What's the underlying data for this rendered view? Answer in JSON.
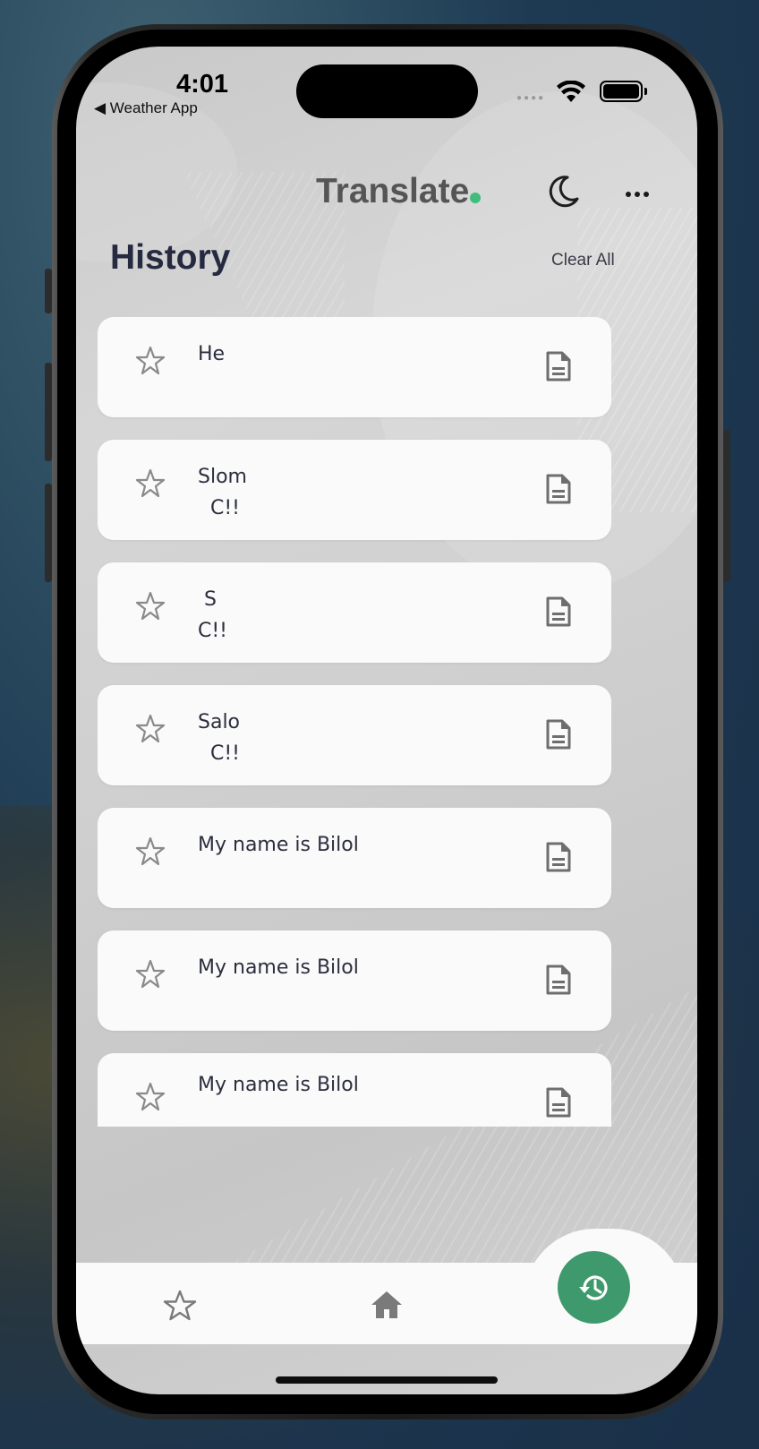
{
  "status_bar": {
    "time": "4:01",
    "back_app": "◀ Weather App"
  },
  "header": {
    "brand": "Translate",
    "theme_icon": "moon-icon",
    "more_icon": "more-dots-icon"
  },
  "page": {
    "title": "History",
    "clear_all": "Clear All"
  },
  "history": [
    {
      "text": "He"
    },
    {
      "text": "Slom\n  C!!"
    },
    {
      "text": " S\nC!!"
    },
    {
      "text": "Salo\n  C!!"
    },
    {
      "text": "My name is Bilol"
    },
    {
      "text": "My name is Bilol"
    },
    {
      "text": "My name is Bilol"
    }
  ],
  "bottom_nav": {
    "items": [
      {
        "name": "favorites",
        "icon": "star-icon"
      },
      {
        "name": "home",
        "icon": "home-icon"
      },
      {
        "name": "history",
        "icon": "history-icon",
        "active": true
      }
    ]
  },
  "colors": {
    "accent": "#3e9a6c",
    "brand_dot": "#3fbd7a",
    "title": "#262a40",
    "card": "#fafafa"
  }
}
